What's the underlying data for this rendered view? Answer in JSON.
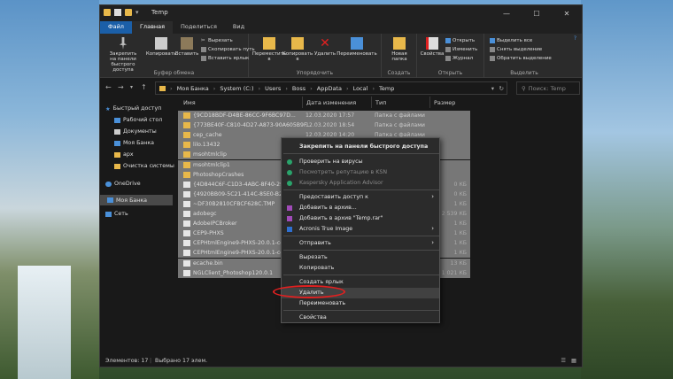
{
  "window": {
    "title": "Temp",
    "qa_title": "Temp"
  },
  "window_controls": [
    "—",
    "☐",
    "✕"
  ],
  "tabs": [
    "Файл",
    "Главная",
    "Поделиться",
    "Вид"
  ],
  "ribbon": {
    "clipboard": {
      "pin": "Закрепить на панели быстрого доступа",
      "copy": "Копировать",
      "paste": "Вставить",
      "cut": "Вырезать",
      "copy_path": "Скопировать путь",
      "paste_shortcut": "Вставить ярлык",
      "label": "Буфер обмена"
    },
    "organize": {
      "move": "Переместить в",
      "copy_to": "Копировать в",
      "delete": "Удалить",
      "rename": "Переименовать",
      "label": "Упорядочить"
    },
    "create": {
      "new_folder": "Новая папка",
      "label": "Создать"
    },
    "open": {
      "props": "Свойства",
      "open": "Открыть",
      "edit": "Изменить",
      "journal": "Журнал",
      "label": "Открыть"
    },
    "select": {
      "all": "Выделить все",
      "none": "Снять выделение",
      "invert": "Обратить выделение",
      "label": "Выделить"
    }
  },
  "address": {
    "crumbs": [
      "Моя Банка",
      "System (C:)",
      "Users",
      "Boss",
      "AppData",
      "Local",
      "Temp"
    ],
    "search_placeholder": "Поиск: Temp"
  },
  "nav": {
    "quick": "Быстрый доступ",
    "desktop": "Рабочий стол",
    "docs": "Документы",
    "mybank": "Моя Банка",
    "apx": "apx",
    "clean": "Очистка системы",
    "onedrive": "OneDrive",
    "mybank2": "Моя Банка",
    "network": "Сеть"
  },
  "columns": {
    "name": "Имя",
    "date": "Дата изменения",
    "type": "Тип",
    "size": "Размер"
  },
  "files": [
    {
      "name": "{9CD18BDF-D4BE-86CC-9F6BC97D...",
      "date": "12.03.2020 17:57",
      "type": "Папка с файлами",
      "size": ""
    },
    {
      "name": "{773BE40F-C810-4D27-A873-90A605B9F...",
      "date": "12.03.2020 18:54",
      "type": "Папка с файлами",
      "size": ""
    },
    {
      "name": "cep_cache",
      "date": "12.03.2020 14:20",
      "type": "Папка с файлами",
      "size": ""
    },
    {
      "name": "lilo.13432",
      "date": "",
      "type": "",
      "size": ""
    },
    {
      "name": "msohtmlclip",
      "date": "",
      "type": "",
      "size": ""
    },
    {
      "name": "msohtmlclip1",
      "date": "",
      "type": "",
      "size": ""
    },
    {
      "name": "PhotoshopCrashes",
      "date": "",
      "type": "",
      "size": ""
    },
    {
      "name": "{4D844C6F-C1D3-4ABC-8F40-2900...",
      "date": "",
      "type": "",
      "size": "0 КБ"
    },
    {
      "name": "{4920BB09-5C21-414C-85E0-B2EB9...",
      "date": "",
      "type": "",
      "size": "0 КБ"
    },
    {
      "name": "~DF30B2810CFBCF628C.TMP",
      "date": "",
      "type": "",
      "size": "1 КБ"
    },
    {
      "name": "adobegc",
      "date": "",
      "type": "",
      "size": "2 539 КБ"
    },
    {
      "name": "AdobeIPCBroker",
      "date": "",
      "type": "",
      "size": "1 КБ"
    },
    {
      "name": "CEP9-PHXS",
      "date": "",
      "type": "",
      "size": "1 КБ"
    },
    {
      "name": "CEPHtmlEngine9-PHXS-20.0.1-com...",
      "date": "",
      "type": "",
      "size": "1 КБ"
    },
    {
      "name": "CEPHtmlEngine9-PHXS-20.0.1-com...",
      "date": "",
      "type": "",
      "size": "1 КБ"
    },
    {
      "name": "ecache.bin",
      "date": "",
      "type": "",
      "size": "13 КБ"
    },
    {
      "name": "NGLClient_Photoshop120.0.1",
      "date": "",
      "type": "",
      "size": "1 021 КБ"
    }
  ],
  "status": {
    "count": "Элементов: 17",
    "selected": "Выбрано 17 элем."
  },
  "context_menu": {
    "pin": "Закрепить на панели быстрого доступа",
    "scan": "Проверить на вирусы",
    "reputation": "Посмотреть репутацию в KSN",
    "advisor": "Kaspersky Application Advisor",
    "access": "Предоставить доступ к",
    "archive": "Добавить в архив...",
    "archive_rar": "Добавить в архив \"Temp.rar\"",
    "acronis": "Acronis True Image",
    "send": "Отправить",
    "cut": "Вырезать",
    "copy": "Копировать",
    "shortcut": "Создать ярлык",
    "delete": "Удалить",
    "rename": "Переименовать",
    "props": "Свойства"
  },
  "colors": {
    "accent": "#1b5fa8",
    "folder": "#e8b84a",
    "highlight": "#e02020"
  }
}
